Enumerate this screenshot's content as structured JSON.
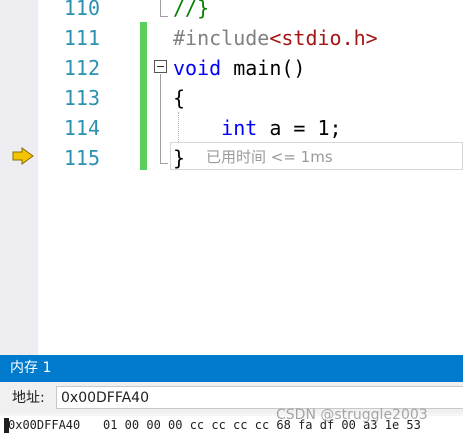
{
  "editor": {
    "lines": [
      {
        "number": "110",
        "segments": [
          {
            "text": "//}",
            "kind": "comment"
          }
        ]
      },
      {
        "number": "111",
        "segments": [
          {
            "text": "#include",
            "kind": "prep"
          },
          {
            "text": "<stdio.h>",
            "kind": "str"
          }
        ]
      },
      {
        "number": "112",
        "segments": [
          {
            "text": "void",
            "kind": "kw"
          },
          {
            "text": " main()",
            "kind": "plain"
          }
        ]
      },
      {
        "number": "113",
        "segments": [
          {
            "text": "{",
            "kind": "plain"
          }
        ]
      },
      {
        "number": "114",
        "segments": [
          {
            "text": "    ",
            "kind": "plain"
          },
          {
            "text": "int",
            "kind": "kw"
          },
          {
            "text": " a = 1;",
            "kind": "plain"
          }
        ]
      },
      {
        "number": "115",
        "segments": [
          {
            "text": "}",
            "kind": "plain"
          }
        ]
      }
    ],
    "perf_tip": "已用时间 <= 1ms",
    "icons": {
      "execution_pointer": "yellow-arrow-icon",
      "collapse": "collapse-minus-icon"
    },
    "colors": {
      "line_number": "#2b91af",
      "keyword": "#0000ff",
      "string": "#a31515",
      "comment": "#008000",
      "change_bar": "#5ad05a",
      "arrow": "#f5c400"
    }
  },
  "memory": {
    "title": "内存 1",
    "address_label": "地址:",
    "address_value": "0x00DFFA40",
    "row_address": "0x00DFFA40",
    "row_bytes": "01 00 00 00 cc cc cc cc 68 fa df 00 a3 1e 53"
  },
  "watermark": "CSDN @struggle2003",
  "colors": {
    "memory_title_bg": "#007acc"
  }
}
